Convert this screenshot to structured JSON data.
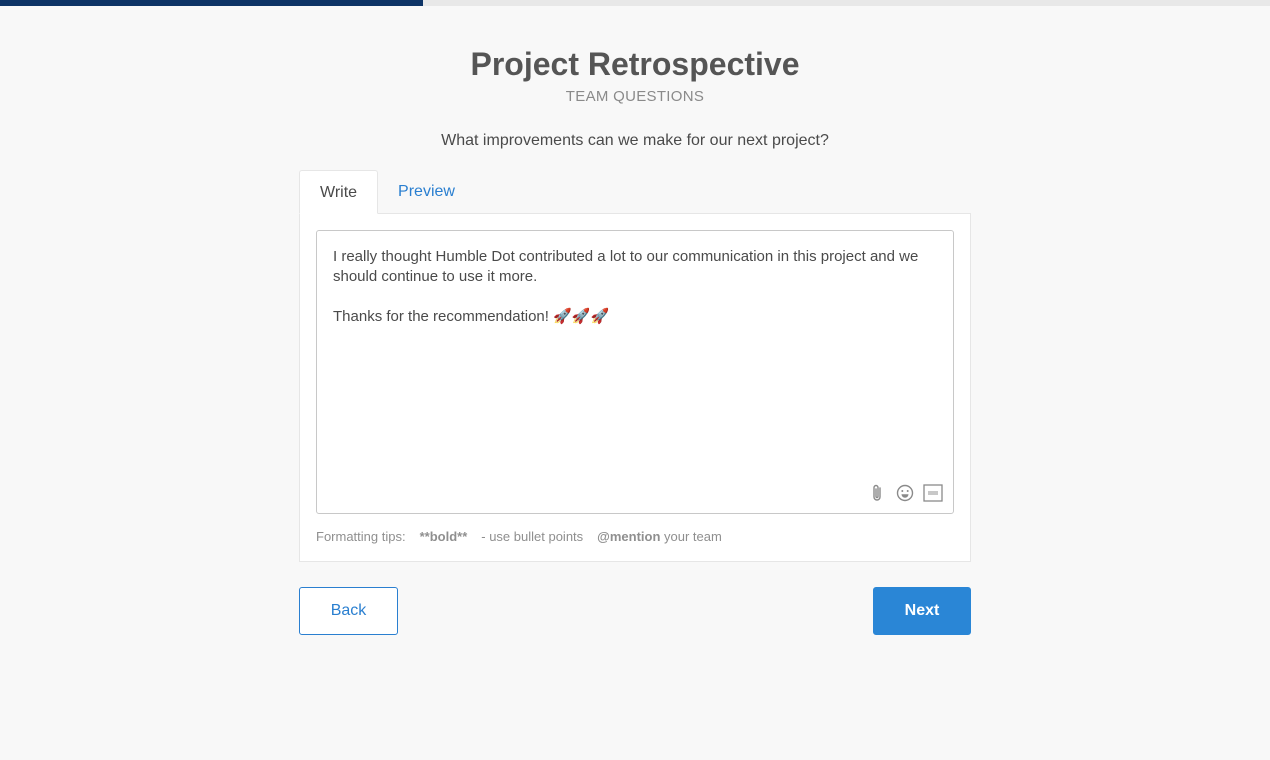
{
  "progress": {
    "fraction": 0.333
  },
  "header": {
    "title": "Project Retrospective",
    "subtitle": "TEAM QUESTIONS"
  },
  "question": "What improvements can we make for our next project?",
  "tabs": [
    {
      "label": "Write",
      "active": true
    },
    {
      "label": "Preview",
      "active": false
    }
  ],
  "editor": {
    "value": "I really thought Humble Dot contributed a lot to our communication in this project and we should continue to use it more.\n\nThanks for the recommendation! 🚀🚀🚀",
    "tools": [
      "paperclip-icon",
      "smiley-icon",
      "gif-icon"
    ]
  },
  "tips": {
    "label": "Formatting tips:",
    "bold": "**bold**",
    "bullets": "- use bullet points",
    "mention_bold": "@mention",
    "mention_rest": "your team"
  },
  "buttons": {
    "back": "Back",
    "next": "Next"
  },
  "colors": {
    "progress": "#0e3466",
    "accent": "#2a86d6"
  }
}
